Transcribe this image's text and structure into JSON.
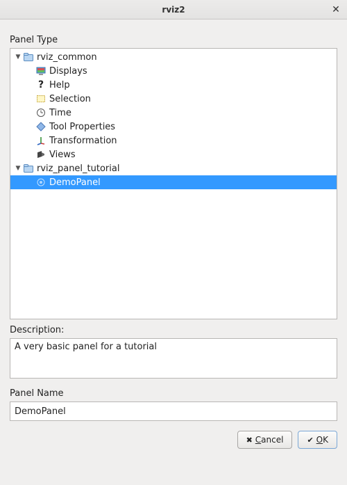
{
  "window": {
    "title": "rviz2"
  },
  "labels": {
    "panel_type": "Panel Type",
    "description": "Description:",
    "panel_name": "Panel Name"
  },
  "tree": {
    "groups": [
      {
        "name": "rviz_common",
        "expanded": true,
        "items": [
          {
            "label": "Displays",
            "icon": "displays-icon"
          },
          {
            "label": "Help",
            "icon": "help-icon"
          },
          {
            "label": "Selection",
            "icon": "selection-icon"
          },
          {
            "label": "Time",
            "icon": "time-icon"
          },
          {
            "label": "Tool Properties",
            "icon": "tool-properties-icon"
          },
          {
            "label": "Transformation",
            "icon": "transformation-icon"
          },
          {
            "label": "Views",
            "icon": "views-icon"
          }
        ]
      },
      {
        "name": "rviz_panel_tutorial",
        "expanded": true,
        "items": [
          {
            "label": "DemoPanel",
            "icon": "demo-panel-icon",
            "selected": true
          }
        ]
      }
    ]
  },
  "description": {
    "text": "A very basic panel for a tutorial"
  },
  "panel_name": {
    "value": "DemoPanel"
  },
  "buttons": {
    "cancel": "Cancel",
    "ok": "OK"
  }
}
